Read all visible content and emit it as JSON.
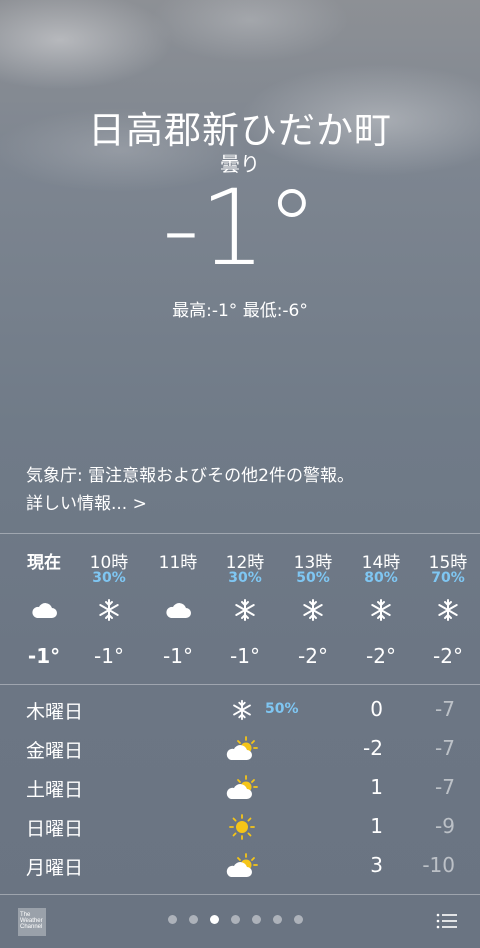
{
  "location": {
    "name": "日高郡新ひだか町",
    "condition": "曇り",
    "temperature": "-1°",
    "high_low": "最高:-1° 最低:-6°"
  },
  "alert": {
    "text": "気象庁: 雷注意報およびその他2件の警報。",
    "more": "詳しい情報... >"
  },
  "hourly": [
    {
      "label": "現在",
      "pct": "",
      "icon": "cloud-icon",
      "temp": "-1°"
    },
    {
      "label": "10時",
      "pct": "30%",
      "icon": "snow-icon",
      "temp": "-1°"
    },
    {
      "label": "11時",
      "pct": "",
      "icon": "cloud-icon",
      "temp": "-1°"
    },
    {
      "label": "12時",
      "pct": "30%",
      "icon": "snow-icon",
      "temp": "-1°"
    },
    {
      "label": "13時",
      "pct": "50%",
      "icon": "snow-icon",
      "temp": "-2°"
    },
    {
      "label": "14時",
      "pct": "80%",
      "icon": "snow-icon",
      "temp": "-2°"
    },
    {
      "label": "15時",
      "pct": "70%",
      "icon": "snow-icon",
      "temp": "-2°"
    }
  ],
  "daily": [
    {
      "day": "木曜日",
      "icon": "snow-icon",
      "pct": "50%",
      "high": "0",
      "low": "-7"
    },
    {
      "day": "金曜日",
      "icon": "partly-cloudy-icon",
      "pct": "",
      "high": "-2",
      "low": "-7"
    },
    {
      "day": "土曜日",
      "icon": "partly-cloudy-icon",
      "pct": "",
      "high": "1",
      "low": "-7"
    },
    {
      "day": "日曜日",
      "icon": "sun-icon",
      "pct": "",
      "high": "1",
      "low": "-9"
    },
    {
      "day": "月曜日",
      "icon": "partly-cloudy-icon",
      "pct": "",
      "high": "3",
      "low": "-10"
    }
  ],
  "footer": {
    "logo_text": "The Weather Channel",
    "page_count": 7,
    "active_page": 3
  },
  "colors": {
    "precip": "#7fc6f2",
    "accent_sun": "#f5c518"
  }
}
